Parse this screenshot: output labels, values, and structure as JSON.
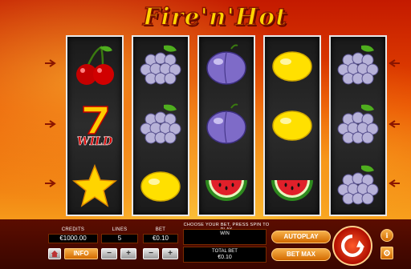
{
  "game": {
    "title": "Fire'n'Hot",
    "reels": [
      [
        "cherries",
        "seven-wild",
        "star"
      ],
      [
        "grapes",
        "grapes",
        "lemon"
      ],
      [
        "plum",
        "plum",
        "watermelon"
      ],
      [
        "lemon",
        "lemon",
        "watermelon"
      ],
      [
        "grapes",
        "grapes",
        "grapes"
      ]
    ],
    "wild_text": "WILD"
  },
  "controls": {
    "credits_label": "CREDITS",
    "credits_value": "€1000.00",
    "lines_label": "LINES",
    "lines_value": "5",
    "bet_label": "BET",
    "bet_value": "€0.10",
    "message": "CHOOSE YOUR BET, PRESS SPIN TO PLAY",
    "win_label": "WIN",
    "win_value": "",
    "total_bet_label": "TOTAL BET",
    "total_bet_value": "€0.10",
    "info_label": "INFO",
    "minus": "−",
    "plus": "+",
    "autoplay_label": "AUTOPLAY",
    "bet_max_label": "BET MAX",
    "info_icon_text": "i"
  },
  "colors": {
    "accent": "#f7a01c",
    "reel_bg": "#222222",
    "logo": "#ffd400"
  }
}
